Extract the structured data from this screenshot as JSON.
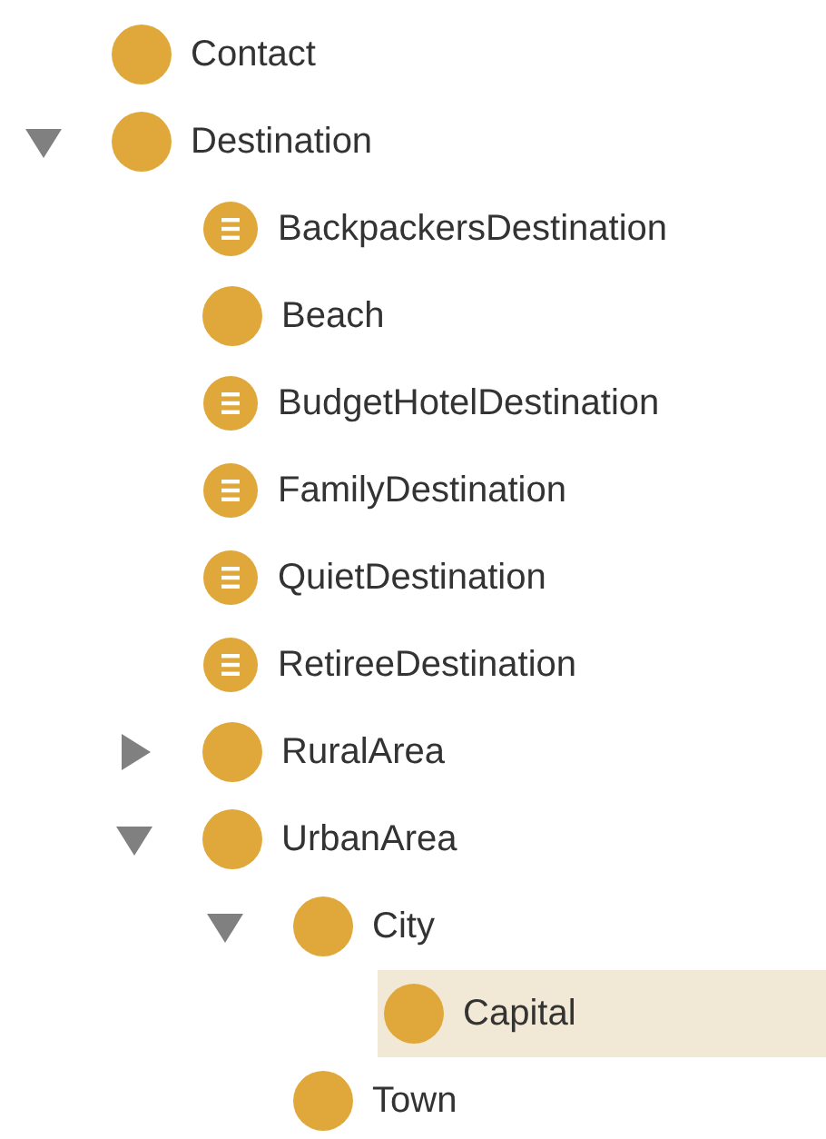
{
  "class_tree": [
    {
      "label": "Contact",
      "kind": "primitive",
      "selected": false
    },
    {
      "label": "Destination",
      "kind": "primitive",
      "selected": false,
      "expanded": true,
      "children": [
        {
          "label": "BackpackersDestination",
          "kind": "defined",
          "selected": false
        },
        {
          "label": "Beach",
          "kind": "primitive",
          "selected": false
        },
        {
          "label": "BudgetHotelDestination",
          "kind": "defined",
          "selected": false
        },
        {
          "label": "FamilyDestination",
          "kind": "defined",
          "selected": false
        },
        {
          "label": "QuietDestination",
          "kind": "defined",
          "selected": false
        },
        {
          "label": "RetireeDestination",
          "kind": "defined",
          "selected": false
        },
        {
          "label": "RuralArea",
          "kind": "primitive",
          "selected": false,
          "expanded": false
        },
        {
          "label": "UrbanArea",
          "kind": "primitive",
          "selected": false,
          "expanded": true,
          "children": [
            {
              "label": "City",
              "kind": "primitive",
              "selected": false,
              "expanded": true,
              "children": [
                {
                  "label": "Capital",
                  "kind": "primitive",
                  "selected": true
                }
              ]
            },
            {
              "label": "Town",
              "kind": "primitive",
              "selected": false
            }
          ]
        }
      ]
    }
  ]
}
